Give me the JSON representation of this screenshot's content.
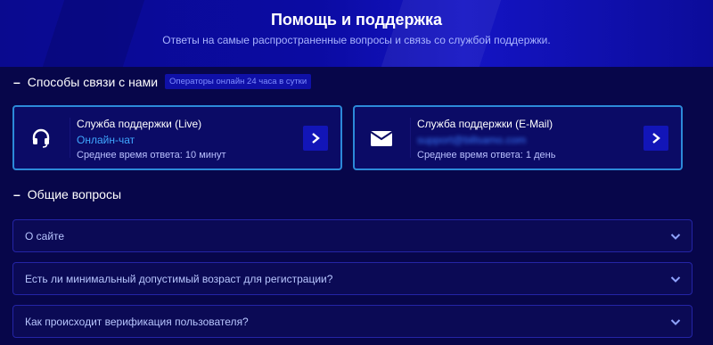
{
  "hero": {
    "title": "Помощь и поддержка",
    "subtitle": "Ответы на самые распространенные вопросы и связь со службой поддержки."
  },
  "contact_section": {
    "heading": "Способы связи с нами",
    "badge": "Операторы онлайн 24 часа в сутки",
    "cards": [
      {
        "title": "Служба поддержки (Live)",
        "link": "Онлайн-чат",
        "response_time": "Среднее время ответа: 10 минут",
        "icon": "headset-icon"
      },
      {
        "title": "Служба поддержки (E-Mail)",
        "link": "support@billsamo.com",
        "response_time": "Среднее время ответа: 1 день",
        "icon": "envelope-icon"
      }
    ]
  },
  "faq_section": {
    "heading": "Общие вопросы",
    "items": [
      "О сайте",
      "Есть ли минимальный допустимый возраст для регистрации?",
      "Как происходит верификация пользователя?"
    ]
  },
  "colors": {
    "background": "#07064a",
    "accent_border": "#2c8ad9",
    "link": "#3fa7ff",
    "button": "#1215b8"
  }
}
